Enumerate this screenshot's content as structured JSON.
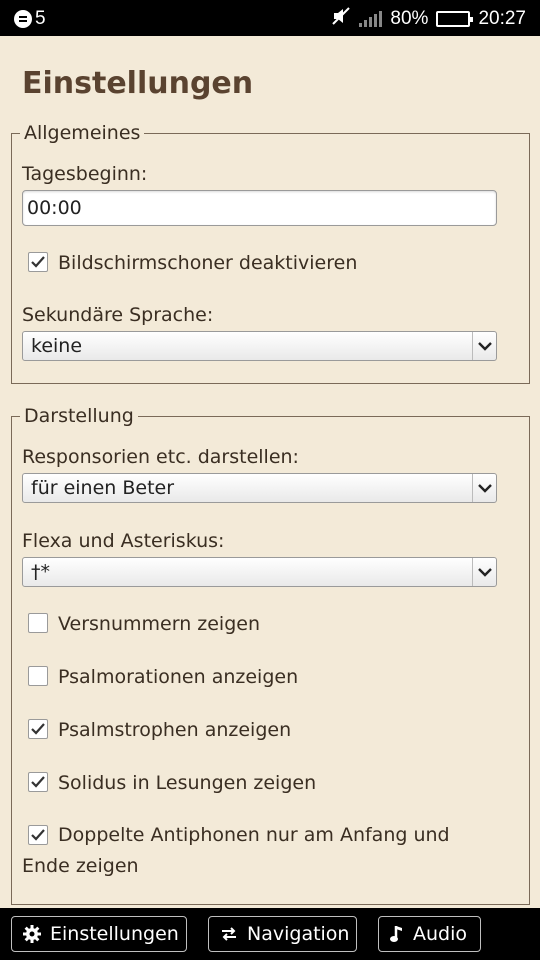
{
  "statusbar": {
    "notif_count": "5",
    "battery": "80%",
    "battery_level": 0.8,
    "time": "20:27"
  },
  "page": {
    "title": "Einstellungen"
  },
  "general": {
    "legend": "Allgemeines",
    "day_start_label": "Tagesbeginn:",
    "day_start_value": "00:00",
    "screensaver_label": "Bildschirmschoner deaktivieren",
    "screensaver_checked": true,
    "secondary_language_label": "Sekundäre Sprache:",
    "secondary_language_value": "keine"
  },
  "display": {
    "legend": "Darstellung",
    "responsories_label": "Responsorien etc. darstellen:",
    "responsories_value": "für einen Beter",
    "flexa_label": "Flexa und Asteriskus:",
    "flexa_value": "†*",
    "options": [
      {
        "label": "Versnummern zeigen",
        "checked": false
      },
      {
        "label": "Psalmorationen anzeigen",
        "checked": false
      },
      {
        "label": "Psalmstrophen anzeigen",
        "checked": true
      },
      {
        "label": "Solidus in Lesungen zeigen",
        "checked": true
      },
      {
        "label": "Doppelte Antiphonen nur am Anfang und Ende zeigen",
        "checked": true
      }
    ]
  },
  "bottom_nav": {
    "settings": "Einstellungen",
    "navigation": "Navigation",
    "audio": "Audio"
  },
  "icons": {
    "notification": "notification-icon",
    "mute": "mute-icon",
    "signal": "signal-icon",
    "battery": "battery-icon",
    "settings": "gear-icon",
    "navigation": "swap-arrows-icon",
    "audio": "music-note-icon",
    "dropdown": "chevron-down-icon",
    "check": "check-icon"
  }
}
